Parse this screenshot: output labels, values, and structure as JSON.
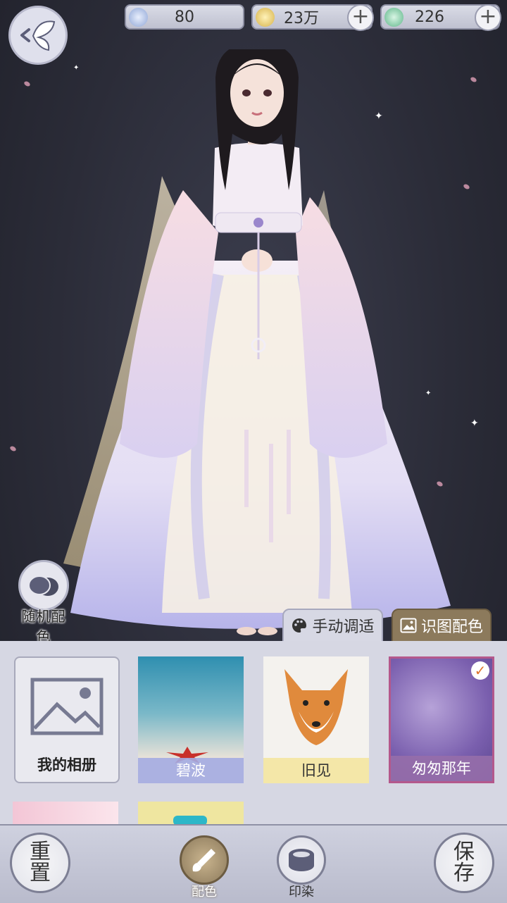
{
  "currencies": [
    {
      "icon": "silver-coin-icon",
      "value": "80",
      "has_plus": false,
      "color": "#8fa6d6"
    },
    {
      "icon": "gold-coin-icon",
      "value": "23万",
      "has_plus": true,
      "color": "#d6b24a"
    },
    {
      "icon": "jade-token-icon",
      "value": "226",
      "has_plus": true,
      "color": "#5fb68a"
    }
  ],
  "random_color": {
    "label": "随机配色"
  },
  "tabs": {
    "manual": "手动调适",
    "recognize": "识图配色"
  },
  "cards": {
    "album": "我的相册",
    "bibo": "碧波",
    "jiujian": "旧见",
    "congcong": "匆匆那年"
  },
  "bottom": {
    "reset": "重置",
    "color": "配色",
    "dye": "印染",
    "save": "保存"
  },
  "colors": {
    "accent_brown": "#8c7a5c",
    "selected_border": "#b4588c",
    "panel": "#d6d7e3"
  }
}
